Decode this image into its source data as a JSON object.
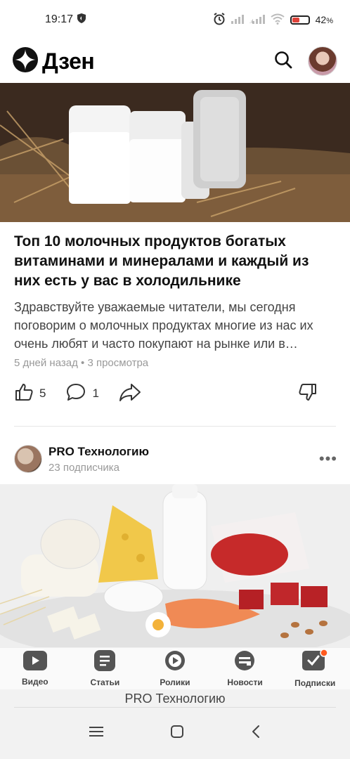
{
  "status_bar": {
    "time": "19:17",
    "battery": "42",
    "battery_unit": "%",
    "battery_level": 0.42,
    "icons": [
      "shield-icon",
      "alarm-icon",
      "signal-icon",
      "signal-icon",
      "wifi-icon",
      "battery-icon"
    ]
  },
  "header": {
    "logo_text": "Дзен",
    "icons": [
      "dzen-logo-icon",
      "search-icon",
      "avatar"
    ]
  },
  "article": {
    "title": "Топ 10 молочных продуктов богатых витаминами и минералами и каждый из них есть у вас в холодильнике",
    "snippet": "Здравствуйте уважаемые читатели, мы сегодня поговорим о молочных продуктах многие из нас их очень любят и часто покупают на рынке или в…",
    "meta": "5 дней назад • 3 просмотра",
    "likes": "5",
    "comments": "1"
  },
  "channel": {
    "name": "PRO Технологию",
    "subscribers": "23 подписчика",
    "more": "•••"
  },
  "bottom_nav": {
    "items": [
      {
        "label": "Видео",
        "icon": "video-icon"
      },
      {
        "label": "Статьи",
        "icon": "articles-icon"
      },
      {
        "label": "Ролики",
        "icon": "clips-icon"
      },
      {
        "label": "Новости",
        "icon": "news-icon"
      },
      {
        "label": "Подписки",
        "icon": "subscriptions-icon"
      }
    ]
  },
  "bottom_title": "PRO Технологию",
  "system_nav": {
    "icons": [
      "menu-icon",
      "home-icon",
      "back-icon"
    ]
  },
  "colors": {
    "accent": "#ff5a1f",
    "text": "#111111",
    "muted": "#999999"
  }
}
